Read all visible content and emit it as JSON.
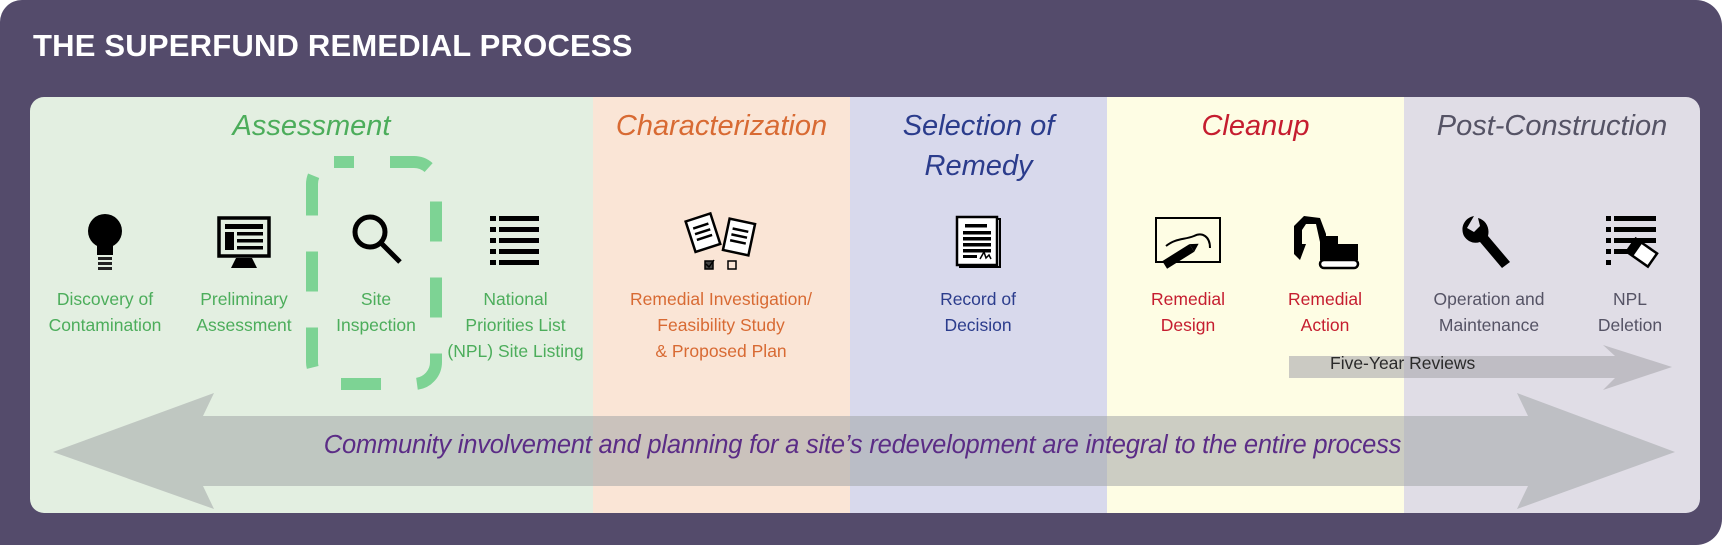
{
  "title": "THE SUPERFUND REMEDIAL PROCESS",
  "phases": [
    {
      "label": "Assessment",
      "color": "#4cad5b"
    },
    {
      "label": "Characterization",
      "color": "#d86a33"
    },
    {
      "label": "Selection of Remedy",
      "line1": "Selection of",
      "line2": "Remedy",
      "color": "#2b3c8c"
    },
    {
      "label": "Cleanup",
      "color": "#c51d2f"
    },
    {
      "label": "Post-Construction",
      "color": "#555365"
    }
  ],
  "steps": [
    {
      "line1": "Discovery of",
      "line2": "Contamination",
      "icon": "lightbulb-icon",
      "phase": "Assessment"
    },
    {
      "line1": "Preliminary",
      "line2": "Assessment",
      "icon": "computer-monitor-icon",
      "phase": "Assessment"
    },
    {
      "line1": "Site",
      "line2": "Inspection",
      "icon": "magnifier-icon",
      "phase": "Assessment",
      "highlighted": true
    },
    {
      "line1": "National",
      "line2": "Priorities List",
      "line3": "(NPL) Site Listing",
      "icon": "list-icon",
      "phase": "Assessment"
    },
    {
      "line1": "Remedial Investigation/",
      "line2": "Feasibility Study",
      "line3": "& Proposed Plan",
      "icon": "documents-checkbox-icon",
      "phase": "Characterization"
    },
    {
      "line1": "Record of",
      "line2": "Decision",
      "icon": "signed-document-icon",
      "phase": "Selection of Remedy"
    },
    {
      "line1": "Remedial",
      "line2": "Design",
      "icon": "drawing-pencil-icon",
      "phase": "Cleanup"
    },
    {
      "line1": "Remedial",
      "line2": "Action",
      "icon": "excavator-icon",
      "phase": "Cleanup"
    },
    {
      "line1": "Operation and",
      "line2": "Maintenance",
      "icon": "wrench-icon",
      "phase": "Post-Construction"
    },
    {
      "line1": "NPL",
      "line2": "Deletion",
      "icon": "list-eraser-icon",
      "phase": "Post-Construction"
    }
  ],
  "five_year_reviews": "Five-Year Reviews",
  "community_banner": "Community involvement and planning for a site’s redevelopment are integral to the entire process"
}
